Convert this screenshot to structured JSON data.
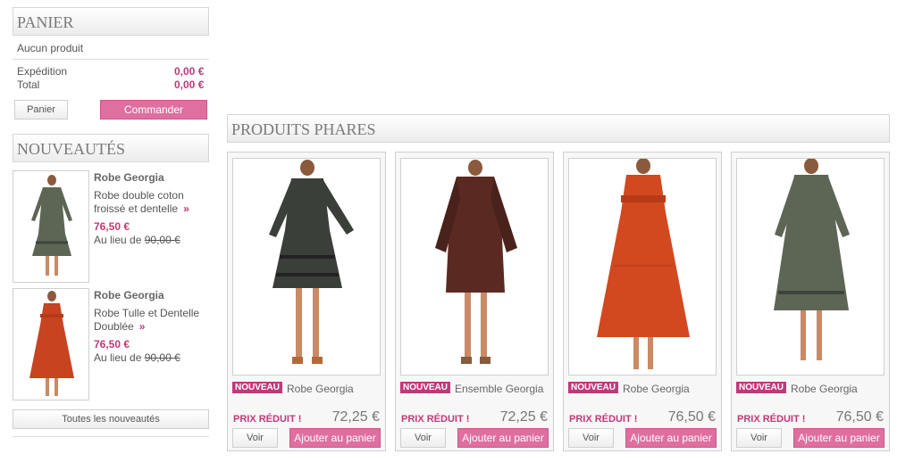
{
  "cart": {
    "title": "PANIER",
    "empty": "Aucun produit",
    "shipping_label": "Expédition",
    "shipping_value": "0,00 €",
    "total_label": "Total",
    "total_value": "0,00 €",
    "cart_button": "Panier",
    "order_button": "Commander"
  },
  "new_products": {
    "title": "NOUVEAUTÉS",
    "items": [
      {
        "brand": "Robe Georgia",
        "desc1": "Robe double coton",
        "desc2": "froissé et dentelle",
        "price": "76,50 €",
        "was_label": "Au lieu de",
        "was_price": "90,00 €"
      },
      {
        "brand": "Robe Georgia",
        "desc1": "Robe Tulle et  Dentelle",
        "desc2": "Doublée",
        "price": "76,50 €",
        "was_label": "Au lieu de",
        "was_price": "90,00 €"
      }
    ],
    "all_button": "Toutes les nouveautés"
  },
  "featured": {
    "title": "PRODUITS PHARES",
    "products": [
      {
        "badge": "NOUVEAU",
        "name": "Robe Georgia",
        "promo": "PRIX RÉDUIT !",
        "price": "72,25 €",
        "view": "Voir",
        "add": "Ajouter au panier"
      },
      {
        "badge": "NOUVEAU",
        "name": "Ensemble Georgia",
        "promo": "PRIX RÉDUIT !",
        "price": "72,25 €",
        "view": "Voir",
        "add": "Ajouter au panier"
      },
      {
        "badge": "NOUVEAU",
        "name": "Robe Georgia",
        "promo": "PRIX RÉDUIT !",
        "price": "76,50 €",
        "view": "Voir",
        "add": "Ajouter au panier"
      },
      {
        "badge": "NOUVEAU",
        "name": "Robe Georgia",
        "promo": "PRIX RÉDUIT !",
        "price": "76,50 €",
        "view": "Voir",
        "add": "Ajouter au panier"
      }
    ]
  },
  "colors": {
    "accent": "#c0397a",
    "button_pink": "#df6f9f"
  }
}
